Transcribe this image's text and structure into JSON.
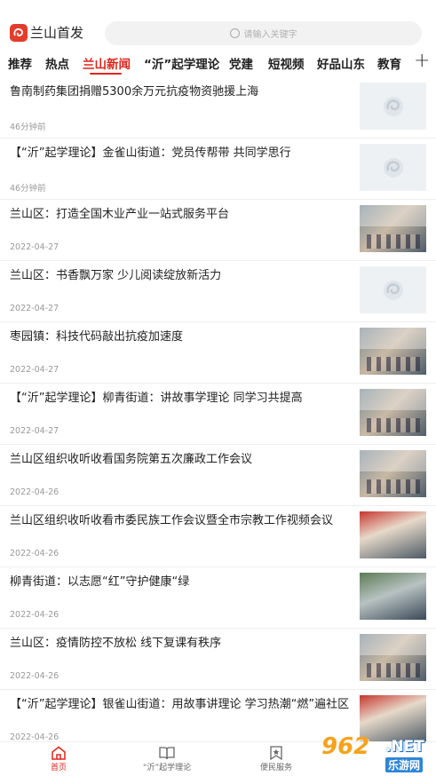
{
  "header": {
    "app_title": "兰山首发",
    "search_placeholder": "请输入关键字"
  },
  "tabs": [
    {
      "label": "推荐"
    },
    {
      "label": "热点"
    },
    {
      "label": "兰山新闻"
    },
    {
      "label": "“沂”起学理论"
    },
    {
      "label": "党建"
    },
    {
      "label": "短视频"
    },
    {
      "label": "好品山东"
    },
    {
      "label": "教育"
    }
  ],
  "active_tab": "兰山新闻",
  "add_tab_label": "+",
  "news": [
    {
      "title": "鲁南制药集团捐赠5300余万元抗疫物资驰援上海",
      "time": "46分钟前",
      "thumb": "placeholder"
    },
    {
      "title": "【“沂”起学理论】金雀山街道：党员传帮带  共同学思行",
      "time": "46分钟前",
      "thumb": "placeholder"
    },
    {
      "title": "兰山区：打造全国木业产业一站式服务平台",
      "time": "2022-04-27",
      "thumb": "photo"
    },
    {
      "title": "兰山区：书香飘万家  少儿阅读绽放新活力",
      "time": "2022-04-27",
      "thumb": "placeholder"
    },
    {
      "title": "枣园镇：科技代码敲出抗疫加速度",
      "time": "2022-04-27",
      "thumb": "photo"
    },
    {
      "title": "【“沂”起学理论】柳青街道：讲故事学理论  同学习共提高",
      "time": "2022-04-27",
      "thumb": "photo"
    },
    {
      "title": "兰山区组织收听收看国务院第五次廉政工作会议",
      "time": "2022-04-26",
      "thumb": "photo"
    },
    {
      "title": "兰山区组织收听收看市委民族工作会议暨全市宗教工作视频会议",
      "time": "2022-04-26",
      "thumb": "red"
    },
    {
      "title": "柳青街道：以志愿“红”守护健康“绿",
      "time": "2022-04-26",
      "thumb": "green"
    },
    {
      "title": "兰山区：疫情防控不放松  线下复课有秩序",
      "time": "2022-04-26",
      "thumb": "photo"
    },
    {
      "title": "【“沂”起学理论】银雀山街道：用故事讲理论  学习热潮“燃”遍社区",
      "time": "2022-04-26",
      "thumb": "red"
    }
  ],
  "bottom_nav": [
    {
      "label": "首页",
      "icon": "home-icon",
      "active": true
    },
    {
      "label": "“沂”起学理论",
      "icon": "book-icon",
      "active": false
    },
    {
      "label": "便民服务",
      "icon": "bookmark-star-icon",
      "active": false
    }
  ],
  "watermark": {
    "number": "962",
    "net": ".NET",
    "sub": "乐游网"
  },
  "colors": {
    "accent": "#e2231a",
    "logo": "#e53b2c"
  }
}
